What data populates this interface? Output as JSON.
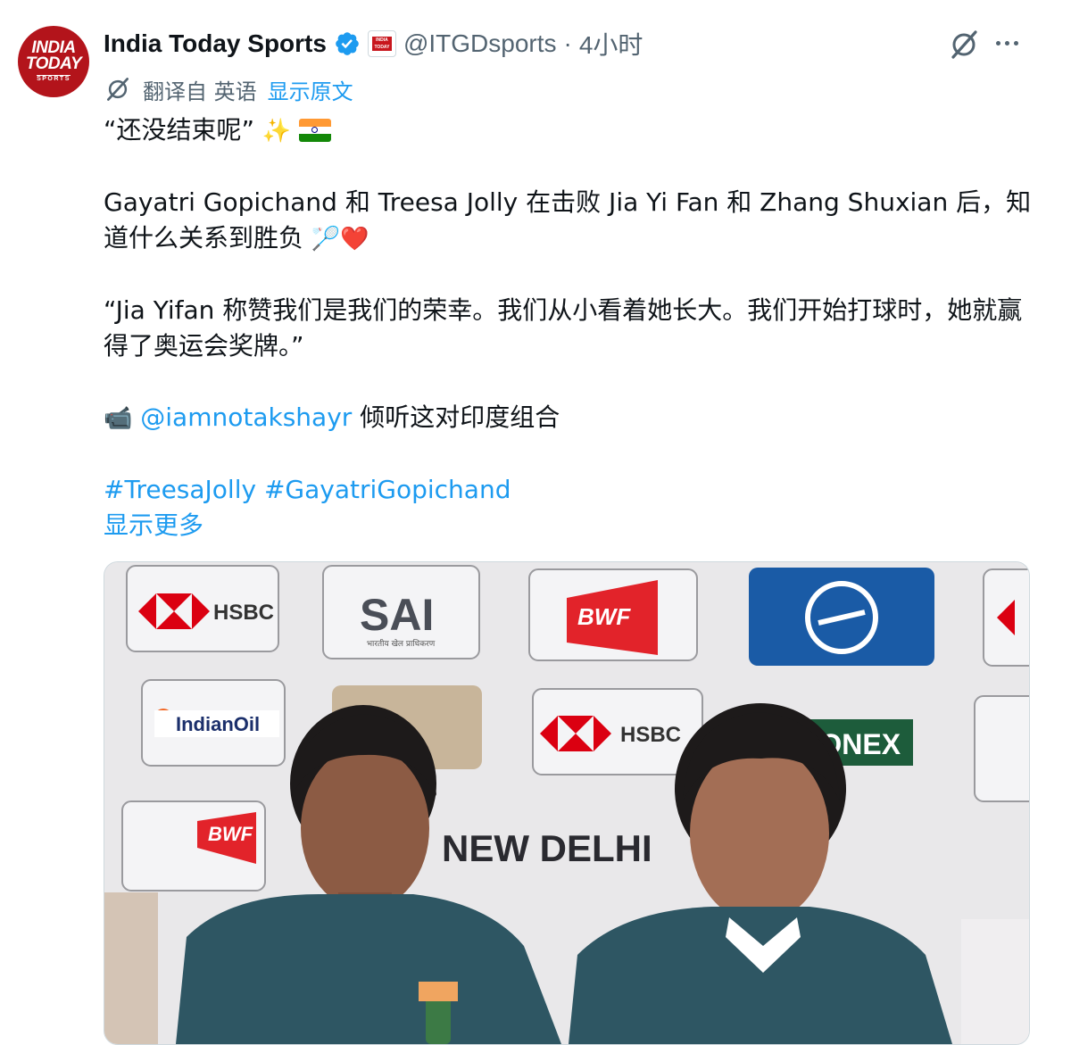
{
  "author": {
    "avatar_lines": [
      "INDIA",
      "TODAY",
      "SPORTS"
    ],
    "display_name": "India Today Sports",
    "handle": "@ITGDsports",
    "separator": "·",
    "time": "4小时",
    "affiliation_badge": [
      "INDIA",
      "TODAY"
    ],
    "verified_icon": "verified-badge-icon"
  },
  "actions": {
    "grok_icon": "grok-icon",
    "more_icon": "more-options-icon"
  },
  "translation": {
    "label": "翻译自 英语",
    "show_original": "显示原文"
  },
  "tweet": {
    "line1": "“还没结束呢”",
    "line1_emoji": "✨",
    "para2": "Gayatri Gopichand 和 Treesa Jolly 在击败 Jia Yi Fan 和 Zhang Shuxian 后，知道什么关系到胜负",
    "para2_emoji": "🏸❤️",
    "para3": "“Jia Yifan 称赞我们是我们的荣幸。我们从小看着她长大。我们开始打球时，她就赢得了奥运会奖牌。”",
    "camera_emoji": "📹",
    "mention": "@iamnotakshayr",
    "mention_rest": " 倾听这对印度组合",
    "hashtags": "#TreesaJolly #GayatriGopichand",
    "show_more": "显示更多"
  },
  "media": {
    "sponsor_boards": [
      "HSBC",
      "SAI",
      "BWF",
      "IndianOil",
      "HSBC",
      "YONEX",
      "BWF",
      "NEW DELHI"
    ],
    "sai_subtitle": "भारतीय खेल प्राधिकरण",
    "colors": {
      "backdrop": "#ecebed",
      "hsbc_red": "#db0011",
      "bwf_red": "#e2232a",
      "lt_blue": "#1a5ba6",
      "jersey": "#2e5663"
    }
  },
  "colors": {
    "link": "#1d9bf0",
    "secondary": "#536471",
    "text": "#0f1419"
  }
}
